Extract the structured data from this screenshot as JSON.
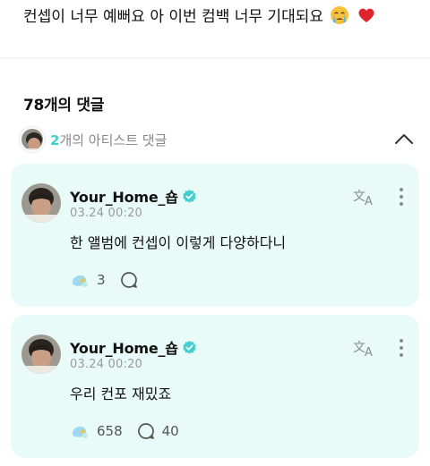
{
  "post": {
    "text": "컨셉이 너무 예뻐요 아 이번 컴백 너무 기대되요",
    "emoji_1": "crying-face",
    "emoji_2": "red-heart"
  },
  "comments_header": {
    "count_label": "78개의 댓글"
  },
  "artist_bar": {
    "count": "2",
    "label": "개의 아티스트 댓글"
  },
  "comments": [
    {
      "author": "Your_Home_숍",
      "verified": true,
      "date": "03.24 00:20",
      "body": "한 앨범에 컨셉이 이렇게 다양하다니",
      "like_count": "3",
      "reply_count": ""
    },
    {
      "author": "Your_Home_숍",
      "verified": true,
      "date": "03.24 00:20",
      "body": "우리 컨포 재밌죠",
      "like_count": "658",
      "reply_count": "40"
    }
  ],
  "colors": {
    "accent": "#3fd0cf",
    "card_background": "#e9fbf8",
    "meta_gray": "#9a9a9a"
  },
  "icons": [
    "crying-face-emoji",
    "heart-emoji",
    "chevron-up-icon",
    "verified-badge-icon",
    "translate-icon",
    "more-vertical-icon",
    "like-icon",
    "reply-icon"
  ]
}
